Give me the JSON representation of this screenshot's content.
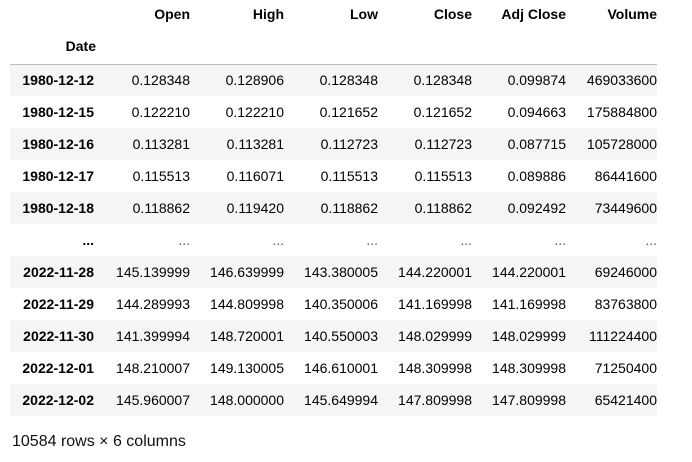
{
  "table": {
    "columns": [
      "Open",
      "High",
      "Low",
      "Close",
      "Adj Close",
      "Volume"
    ],
    "index_name": "Date",
    "rows": [
      {
        "index": "1980-12-12",
        "values": [
          "0.128348",
          "0.128906",
          "0.128348",
          "0.128348",
          "0.099874",
          "469033600"
        ]
      },
      {
        "index": "1980-12-15",
        "values": [
          "0.122210",
          "0.122210",
          "0.121652",
          "0.121652",
          "0.094663",
          "175884800"
        ]
      },
      {
        "index": "1980-12-16",
        "values": [
          "0.113281",
          "0.113281",
          "0.112723",
          "0.112723",
          "0.087715",
          "105728000"
        ]
      },
      {
        "index": "1980-12-17",
        "values": [
          "0.115513",
          "0.116071",
          "0.115513",
          "0.115513",
          "0.089886",
          "86441600"
        ]
      },
      {
        "index": "1980-12-18",
        "values": [
          "0.118862",
          "0.119420",
          "0.118862",
          "0.118862",
          "0.092492",
          "73449600"
        ]
      },
      {
        "index": "...",
        "values": [
          "...",
          "...",
          "...",
          "...",
          "...",
          "..."
        ]
      },
      {
        "index": "2022-11-28",
        "values": [
          "145.139999",
          "146.639999",
          "143.380005",
          "144.220001",
          "144.220001",
          "69246000"
        ]
      },
      {
        "index": "2022-11-29",
        "values": [
          "144.289993",
          "144.809998",
          "140.350006",
          "141.169998",
          "141.169998",
          "83763800"
        ]
      },
      {
        "index": "2022-11-30",
        "values": [
          "141.399994",
          "148.720001",
          "140.550003",
          "148.029999",
          "148.029999",
          "111224400"
        ]
      },
      {
        "index": "2022-12-01",
        "values": [
          "148.210007",
          "149.130005",
          "146.610001",
          "148.309998",
          "148.309998",
          "71250400"
        ]
      },
      {
        "index": "2022-12-02",
        "values": [
          "145.960007",
          "148.000000",
          "145.649994",
          "147.809998",
          "147.809998",
          "65421400"
        ]
      }
    ]
  },
  "shape_note": "10584 rows × 6 columns"
}
